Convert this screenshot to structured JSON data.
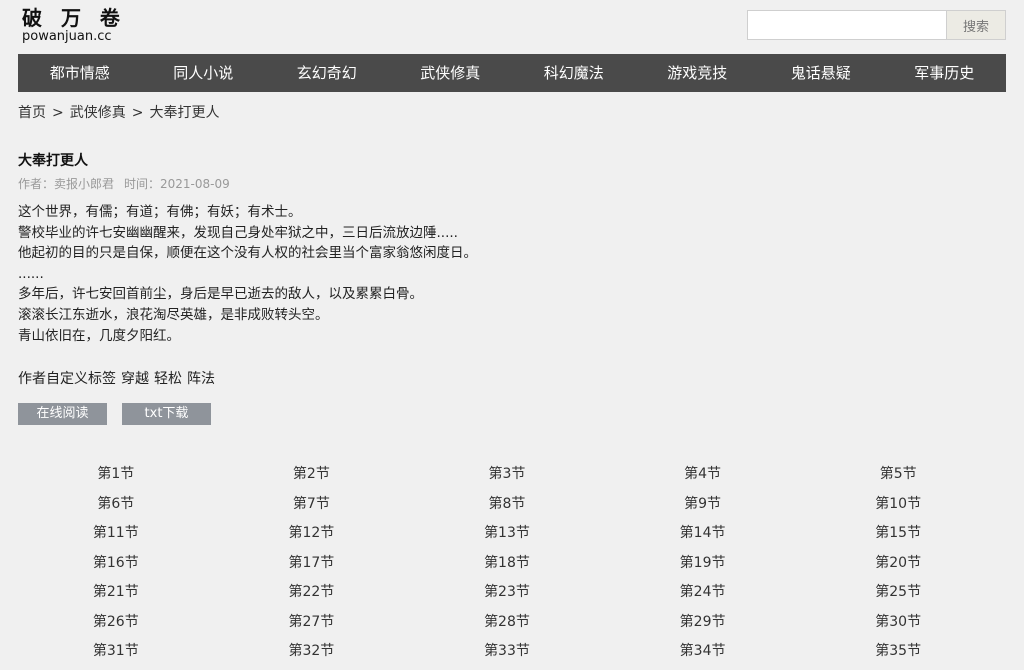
{
  "site": {
    "logo_cn": "破 万 卷",
    "logo_en": "powanjuan.cc"
  },
  "search": {
    "placeholder": "",
    "button_label": "搜索"
  },
  "nav": {
    "items": [
      "都市情感",
      "同人小说",
      "玄幻奇幻",
      "武侠修真",
      "科幻魔法",
      "游戏竞技",
      "鬼话悬疑",
      "军事历史"
    ]
  },
  "breadcrumb": {
    "home": "首页",
    "category": "武侠修真",
    "current": "大奉打更人",
    "separator": ">"
  },
  "book": {
    "title": "大奉打更人",
    "author_label": "作者：卖报小郎君",
    "time_label": "时间：2021-08-09",
    "description": [
      "这个世界，有儒；有道；有佛；有妖；有术士。",
      "警校毕业的许七安幽幽醒来，发现自己身处牢狱之中，三日后流放边陲.....",
      "他起初的目的只是自保，顺便在这个没有人权的社会里当个富家翁悠闲度日。",
      "......",
      "多年后，许七安回首前尘，身后是早已逝去的敌人，以及累累白骨。",
      "滚滚长江东逝水，浪花淘尽英雄，是非成败转头空。",
      "青山依旧在，几度夕阳红。"
    ],
    "tags_label": "作者自定义标签",
    "tags": [
      "穿越",
      "轻松",
      "阵法"
    ]
  },
  "actions": {
    "read_online": "在线阅读",
    "txt_download": "txt下载"
  },
  "chapters": [
    "第1节",
    "第2节",
    "第3节",
    "第4节",
    "第5节",
    "第6节",
    "第7节",
    "第8节",
    "第9节",
    "第10节",
    "第11节",
    "第12节",
    "第13节",
    "第14节",
    "第15节",
    "第16节",
    "第17节",
    "第18节",
    "第19节",
    "第20节",
    "第21节",
    "第22节",
    "第23节",
    "第24节",
    "第25节",
    "第26节",
    "第27节",
    "第28节",
    "第29节",
    "第30节",
    "第31节",
    "第32节",
    "第33节",
    "第34节",
    "第35节"
  ]
}
